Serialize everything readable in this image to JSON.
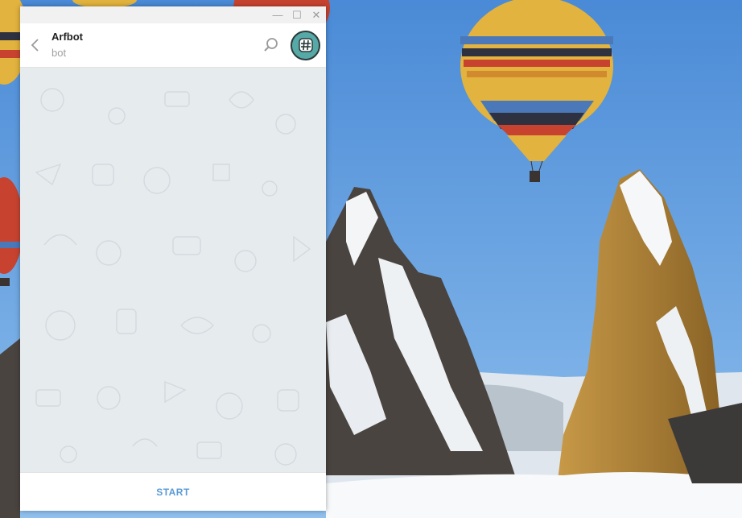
{
  "window": {
    "controls": {
      "minimize": "—",
      "maximize": "☐",
      "close": "✕"
    }
  },
  "header": {
    "peer_name": "Arfbot",
    "peer_status": "bot",
    "back_icon": "chevron-left-icon",
    "search_icon": "search-icon",
    "avatar_icon": "hashtag-icon"
  },
  "composer": {
    "start_label": "START"
  },
  "colors": {
    "accent": "#5a9ad5",
    "chat_bg": "#e6ebee",
    "avatar_bg": "#56a9a6",
    "sky": "#4a8fdc"
  }
}
